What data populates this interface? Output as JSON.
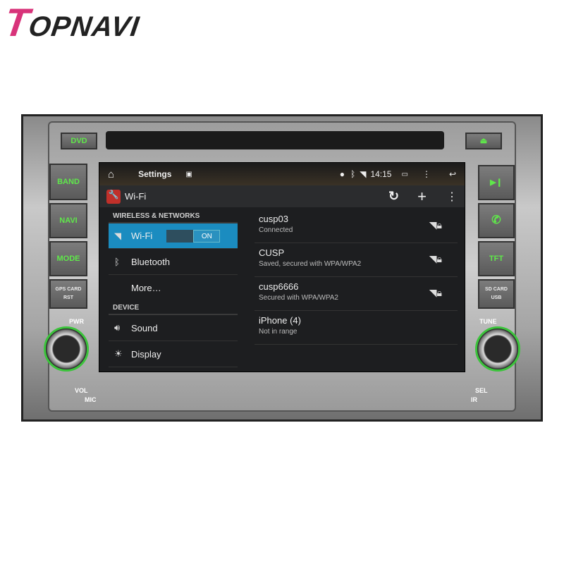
{
  "brand": {
    "logo": "TOPNAVI"
  },
  "device": {
    "left_buttons": [
      "DVD",
      "BAND",
      "NAVI",
      "MODE",
      "GPS CARD RST"
    ],
    "right_buttons": [
      "eject",
      "play-pause",
      "phone",
      "TFT",
      "SD CARD USB"
    ],
    "labels": {
      "pwr": "PWR",
      "vol": "VOL",
      "mic": "MIC",
      "tune": "TUNE",
      "sel": "SEL",
      "ir": "IR"
    }
  },
  "status_bar": {
    "title": "Settings",
    "time": "14:15"
  },
  "action_bar": {
    "title": "Wi-Fi"
  },
  "left_panel": {
    "section1": "WIRELESS & NETWORKS",
    "wifi": {
      "label": "Wi-Fi",
      "toggle": "ON"
    },
    "bluetooth": "Bluetooth",
    "more": "More…",
    "section2": "DEVICE",
    "sound": "Sound",
    "display": "Display"
  },
  "networks": [
    {
      "name": "cusp03",
      "status": "Connected"
    },
    {
      "name": "CUSP",
      "status": "Saved, secured with WPA/WPA2"
    },
    {
      "name": "cusp6666",
      "status": "Secured with WPA/WPA2"
    },
    {
      "name": "iPhone (4)",
      "status": "Not in range"
    }
  ],
  "colors": {
    "accent": "#1b8cc0",
    "button_text": "#5fe84a"
  }
}
